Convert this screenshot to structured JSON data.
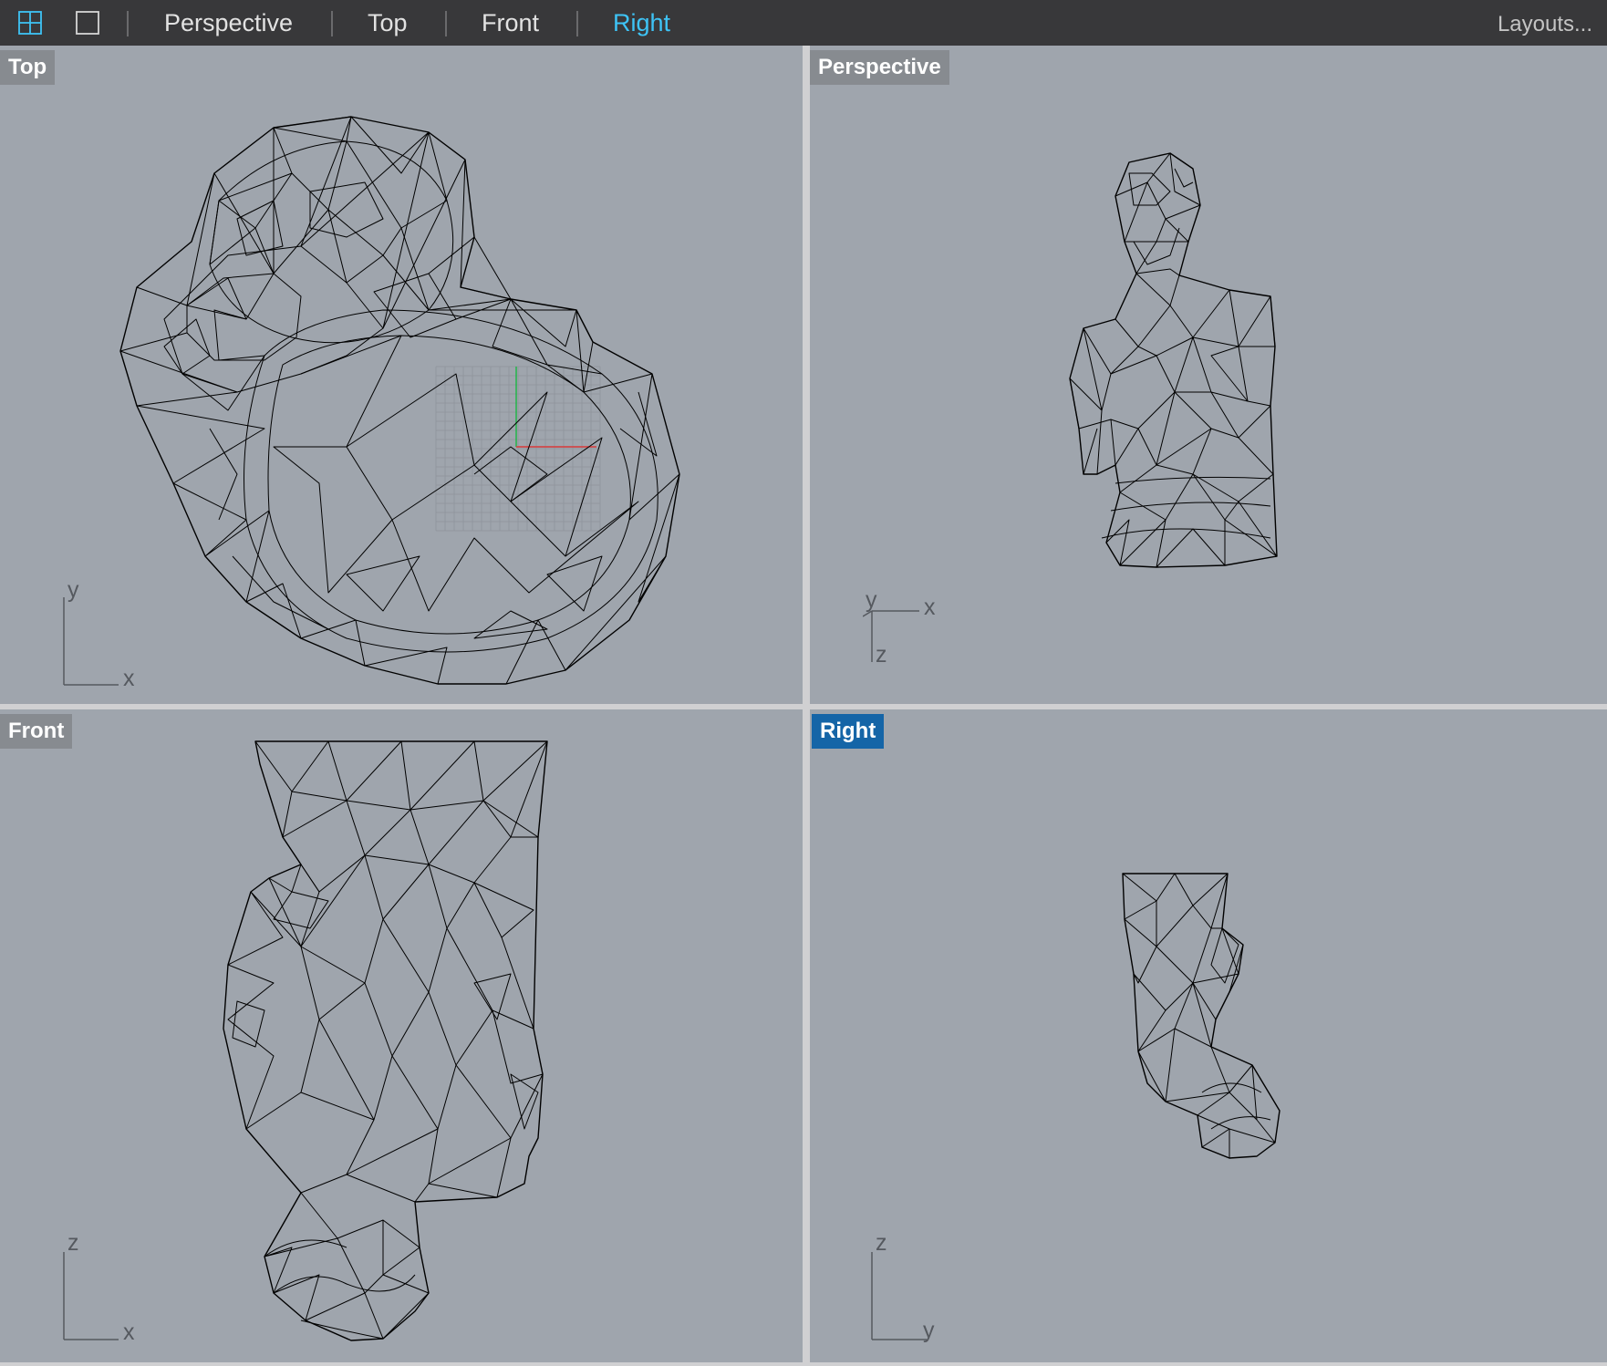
{
  "toolbar": {
    "icons": [
      {
        "name": "four-viewports-icon",
        "active": true
      },
      {
        "name": "single-viewport-icon",
        "active": false
      }
    ],
    "tabs": [
      {
        "label": "Perspective",
        "active": false
      },
      {
        "label": "Top",
        "active": false
      },
      {
        "label": "Front",
        "active": false
      },
      {
        "label": "Right",
        "active": true
      }
    ],
    "layouts_label": "Layouts...",
    "active_color": "#3ec3f5"
  },
  "viewports": {
    "top": {
      "label": "Top",
      "active": false,
      "axes": {
        "vertical": "y",
        "horizontal": "x"
      }
    },
    "perspective": {
      "label": "Perspective",
      "active": false,
      "axes": {
        "a": "y",
        "b": "x",
        "c": "z"
      }
    },
    "front": {
      "label": "Front",
      "active": false,
      "axes": {
        "vertical": "z",
        "horizontal": "x"
      }
    },
    "right": {
      "label": "Right",
      "active": true,
      "axes": {
        "vertical": "z",
        "horizontal": "y"
      }
    }
  },
  "colors": {
    "viewport_background": "#9fa5ad",
    "label_background": "#878b90",
    "active_label_background": "#1565a7",
    "toolbar_background": "#38383a",
    "x_axis": "#d93a3a",
    "y_axis": "#22b54a"
  }
}
